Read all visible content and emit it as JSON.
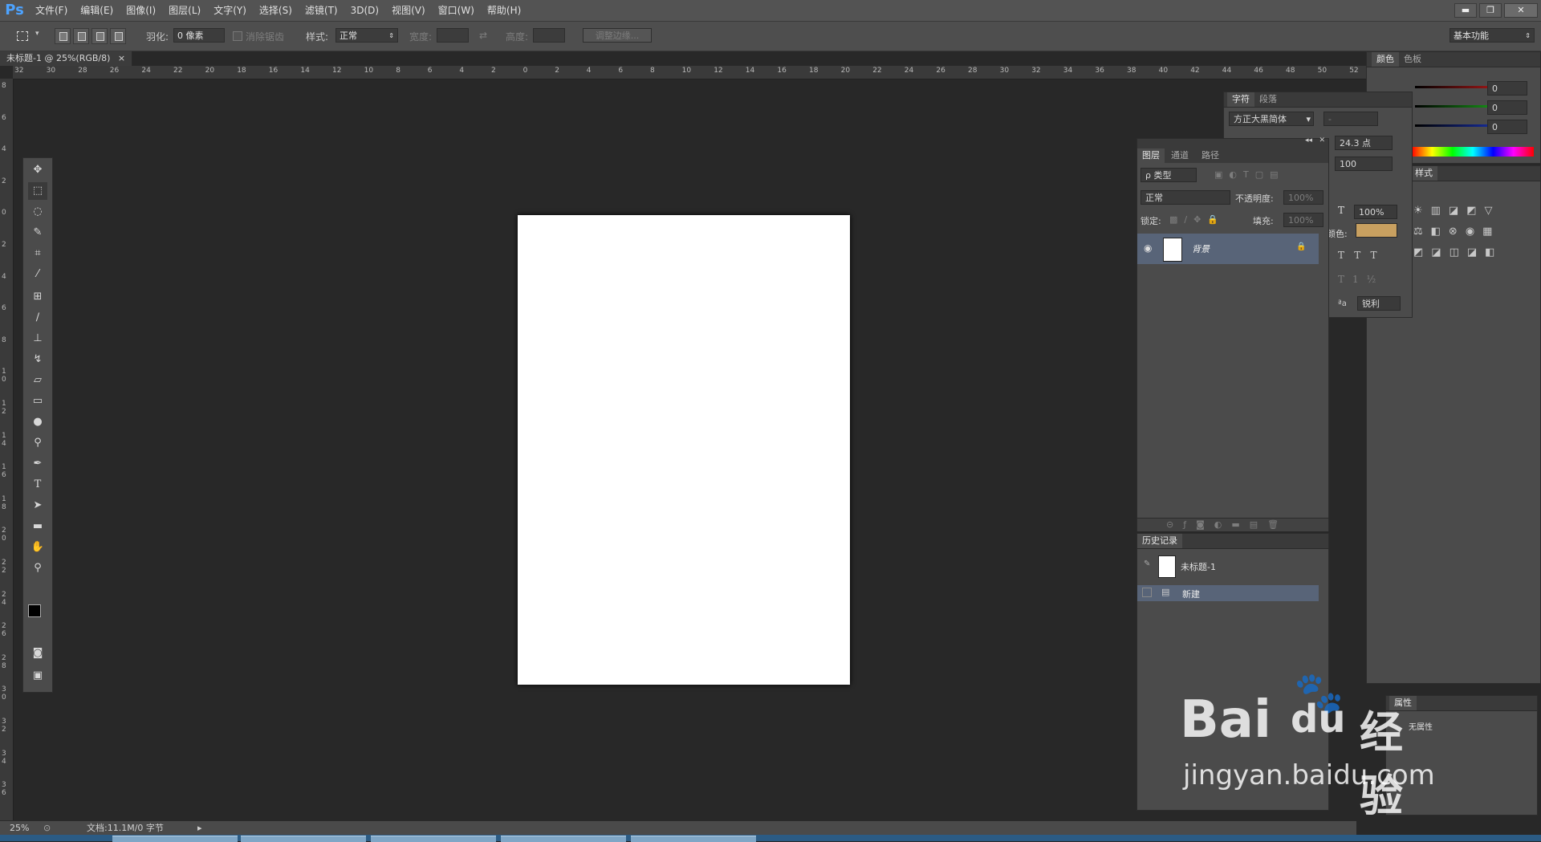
{
  "app": {
    "logo": "Ps"
  },
  "menu": [
    "文件(F)",
    "编辑(E)",
    "图像(I)",
    "图层(L)",
    "文字(Y)",
    "选择(S)",
    "滤镜(T)",
    "3D(D)",
    "视图(V)",
    "窗口(W)",
    "帮助(H)"
  ],
  "window_buttons": {
    "minimize": "▬",
    "restore": "❐",
    "close": "✕"
  },
  "options": {
    "feather_label": "羽化:",
    "feather_value": "0 像素",
    "antialias_label": "消除锯齿",
    "style_label": "样式:",
    "style_value": "正常",
    "width_label": "宽度:",
    "height_label": "高度:",
    "refine_edge": "调整边缘...",
    "workspace": "基本功能"
  },
  "document": {
    "tab_title": "未标题-1 @ 25%(RGB/8)",
    "close": "×"
  },
  "ruler": {
    "h_ticks": [
      "32",
      "30",
      "28",
      "26",
      "24",
      "22",
      "20",
      "18",
      "16",
      "14",
      "12",
      "10",
      "8",
      "6",
      "4",
      "2",
      "0",
      "2",
      "4",
      "6",
      "8",
      "10",
      "12",
      "14",
      "16",
      "18",
      "20",
      "22",
      "24",
      "26",
      "28",
      "30",
      "32",
      "34",
      "36",
      "38",
      "40",
      "42",
      "44",
      "46",
      "48",
      "50",
      "52"
    ],
    "v_ticks": [
      "8",
      "6",
      "4",
      "2",
      "0",
      "2",
      "4",
      "6",
      "8",
      "10",
      "12",
      "14",
      "16",
      "18",
      "20",
      "22",
      "24",
      "26",
      "28",
      "30",
      "32",
      "34",
      "36"
    ]
  },
  "character_panel": {
    "tabs": [
      "字符",
      "段落"
    ],
    "font": "方正大黑简体",
    "font_style": "-",
    "size": "24.3 点",
    "tracking": "100",
    "vscale": "100%",
    "color_label": "颜色:",
    "color": "#c8a060",
    "antialias": "锐利"
  },
  "color_panel": {
    "tabs": [
      "颜色",
      "色板"
    ],
    "r": "0",
    "g": "0",
    "b": "0"
  },
  "adjust_panel": {
    "tab_partial": "样式"
  },
  "layers_panel": {
    "tabs": [
      "图层",
      "通道",
      "路径"
    ],
    "filter": "ρ 类型",
    "blend_mode": "正常",
    "opacity_label": "不透明度:",
    "opacity_value": "100%",
    "lock_label": "锁定:",
    "fill_label": "填充:",
    "fill_value": "100%",
    "layers": [
      {
        "name": "背景",
        "selected": true,
        "locked": true
      }
    ]
  },
  "history_panel": {
    "tab": "历史记录",
    "snapshot": "未标题-1",
    "states": [
      {
        "name": "新建",
        "selected": true
      }
    ]
  },
  "properties_panel": {
    "tab": "属性",
    "text": "无属性"
  },
  "status": {
    "zoom": "25%",
    "doc_info": "文档:11.1M/0 字节"
  },
  "watermark": {
    "brand": "Bai",
    "brand_suffix": "du",
    "cn": "经验",
    "url": "jingyan.baidu.com"
  }
}
